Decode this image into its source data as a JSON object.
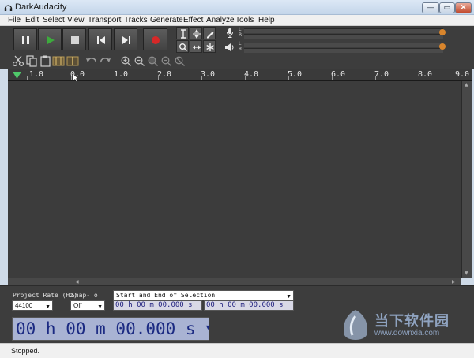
{
  "window": {
    "title": "DarkAudacity",
    "minimize": "—",
    "maximize": "▭",
    "close": "✕"
  },
  "menu": [
    "File",
    "Edit",
    "Select",
    "View",
    "Transport",
    "Tracks",
    "Generate",
    "Effect",
    "Analyze",
    "Tools",
    "Help"
  ],
  "meters": {
    "record_l": "L",
    "record_r": "R",
    "play_l": "L",
    "play_r": "R"
  },
  "ruler": {
    "ticks": [
      "1.0",
      "0.0",
      "1.0",
      "2.0",
      "3.0",
      "4.0",
      "5.0",
      "6.0",
      "7.0",
      "8.0",
      "9.0"
    ]
  },
  "selection": {
    "project_rate_label": "Project Rate (Hz)",
    "project_rate_value": "44100",
    "snap_to_label": "Snap-To",
    "snap_to_value": "Off",
    "mode_value": "Start and End of Selection",
    "start_time": "00 h 00 m 00.000 s",
    "end_time": "00 h 00 m 00.000 s"
  },
  "time_readout": "00 h 00 m 00.000 s",
  "status": "Stopped.",
  "watermark": {
    "title": "当下软件园",
    "url": "www.downxia.com"
  },
  "colors": {
    "play": "#3daa3d",
    "record": "#d62828",
    "meter_knob": "#d9852c",
    "time_text": "#1b2a82"
  }
}
